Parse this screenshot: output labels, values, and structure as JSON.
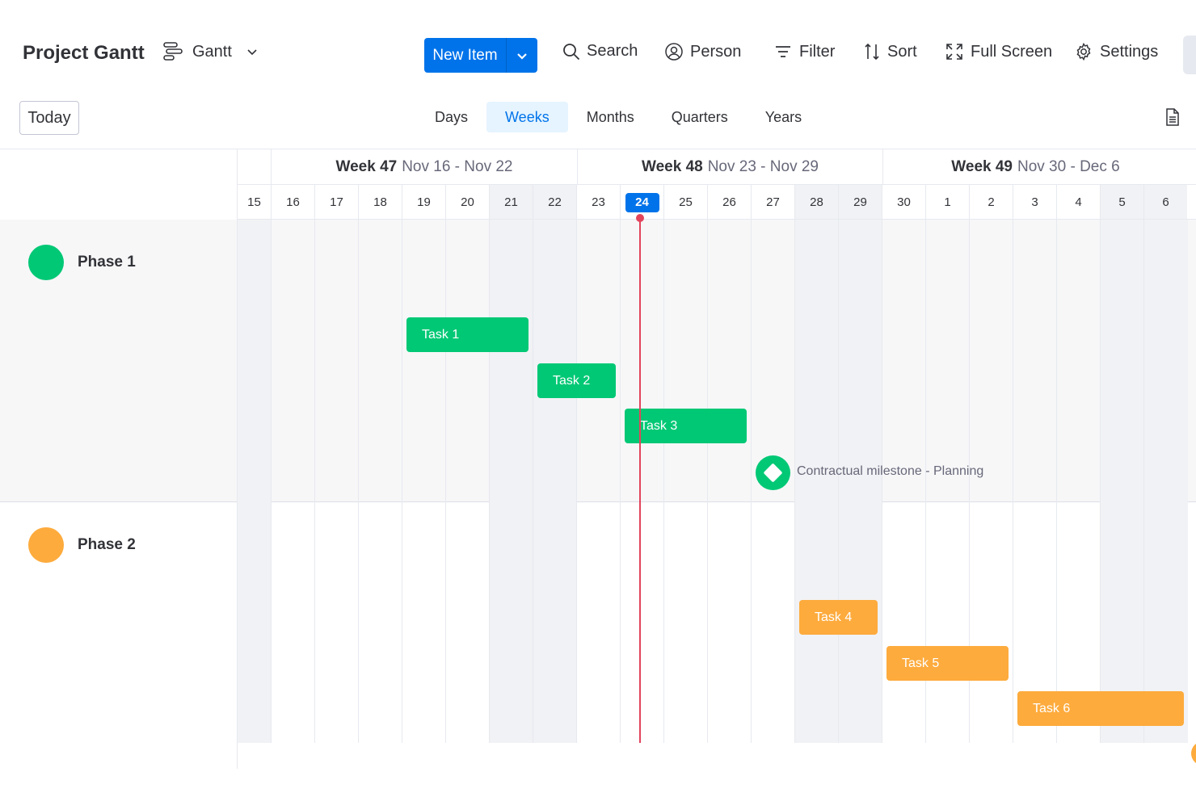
{
  "toolbar": {
    "title": "Project Gantt",
    "view_label": "Gantt",
    "new_item_label": "New Item",
    "search_label": "Search",
    "person_label": "Person",
    "filter_label": "Filter",
    "sort_label": "Sort",
    "fullscreen_label": "Full Screen",
    "settings_label": "Settings"
  },
  "scale": {
    "today_label": "Today",
    "tabs": [
      "Days",
      "Weeks",
      "Months",
      "Quarters",
      "Years"
    ],
    "active_tab": "Weeks"
  },
  "weeks": [
    {
      "label": "Week 47",
      "range": "Nov 16 - Nov 22"
    },
    {
      "label": "Week 48",
      "range": "Nov 23 - Nov 29"
    },
    {
      "label": "Week 49",
      "range": "Nov 30 - Dec 6"
    }
  ],
  "days": [
    "15",
    "16",
    "17",
    "18",
    "19",
    "20",
    "21",
    "22",
    "23",
    "24",
    "25",
    "26",
    "27",
    "28",
    "29",
    "30",
    "1",
    "2",
    "3",
    "4",
    "5",
    "6"
  ],
  "today_day": "24",
  "phases": [
    {
      "name": "Phase 1",
      "color": "#00c875"
    },
    {
      "name": "Phase 2",
      "color": "#fdab3d"
    }
  ],
  "tasks": [
    {
      "label": "Task 1",
      "phase": 0
    },
    {
      "label": "Task 2",
      "phase": 0
    },
    {
      "label": "Task 3",
      "phase": 0
    },
    {
      "label": "Task 4",
      "phase": 1
    },
    {
      "label": "Task 5",
      "phase": 1
    },
    {
      "label": "Task 6",
      "phase": 1
    }
  ],
  "milestone": {
    "label": "Contractual milestone - Planning"
  },
  "icons": {
    "view": "gantt-icon",
    "chevron": "chevron-down-icon",
    "search": "search-icon",
    "person": "person-icon",
    "filter": "filter-icon",
    "sort": "sort-icon",
    "fullscreen": "fullscreen-icon",
    "settings": "gear-icon",
    "export": "export-icon"
  }
}
